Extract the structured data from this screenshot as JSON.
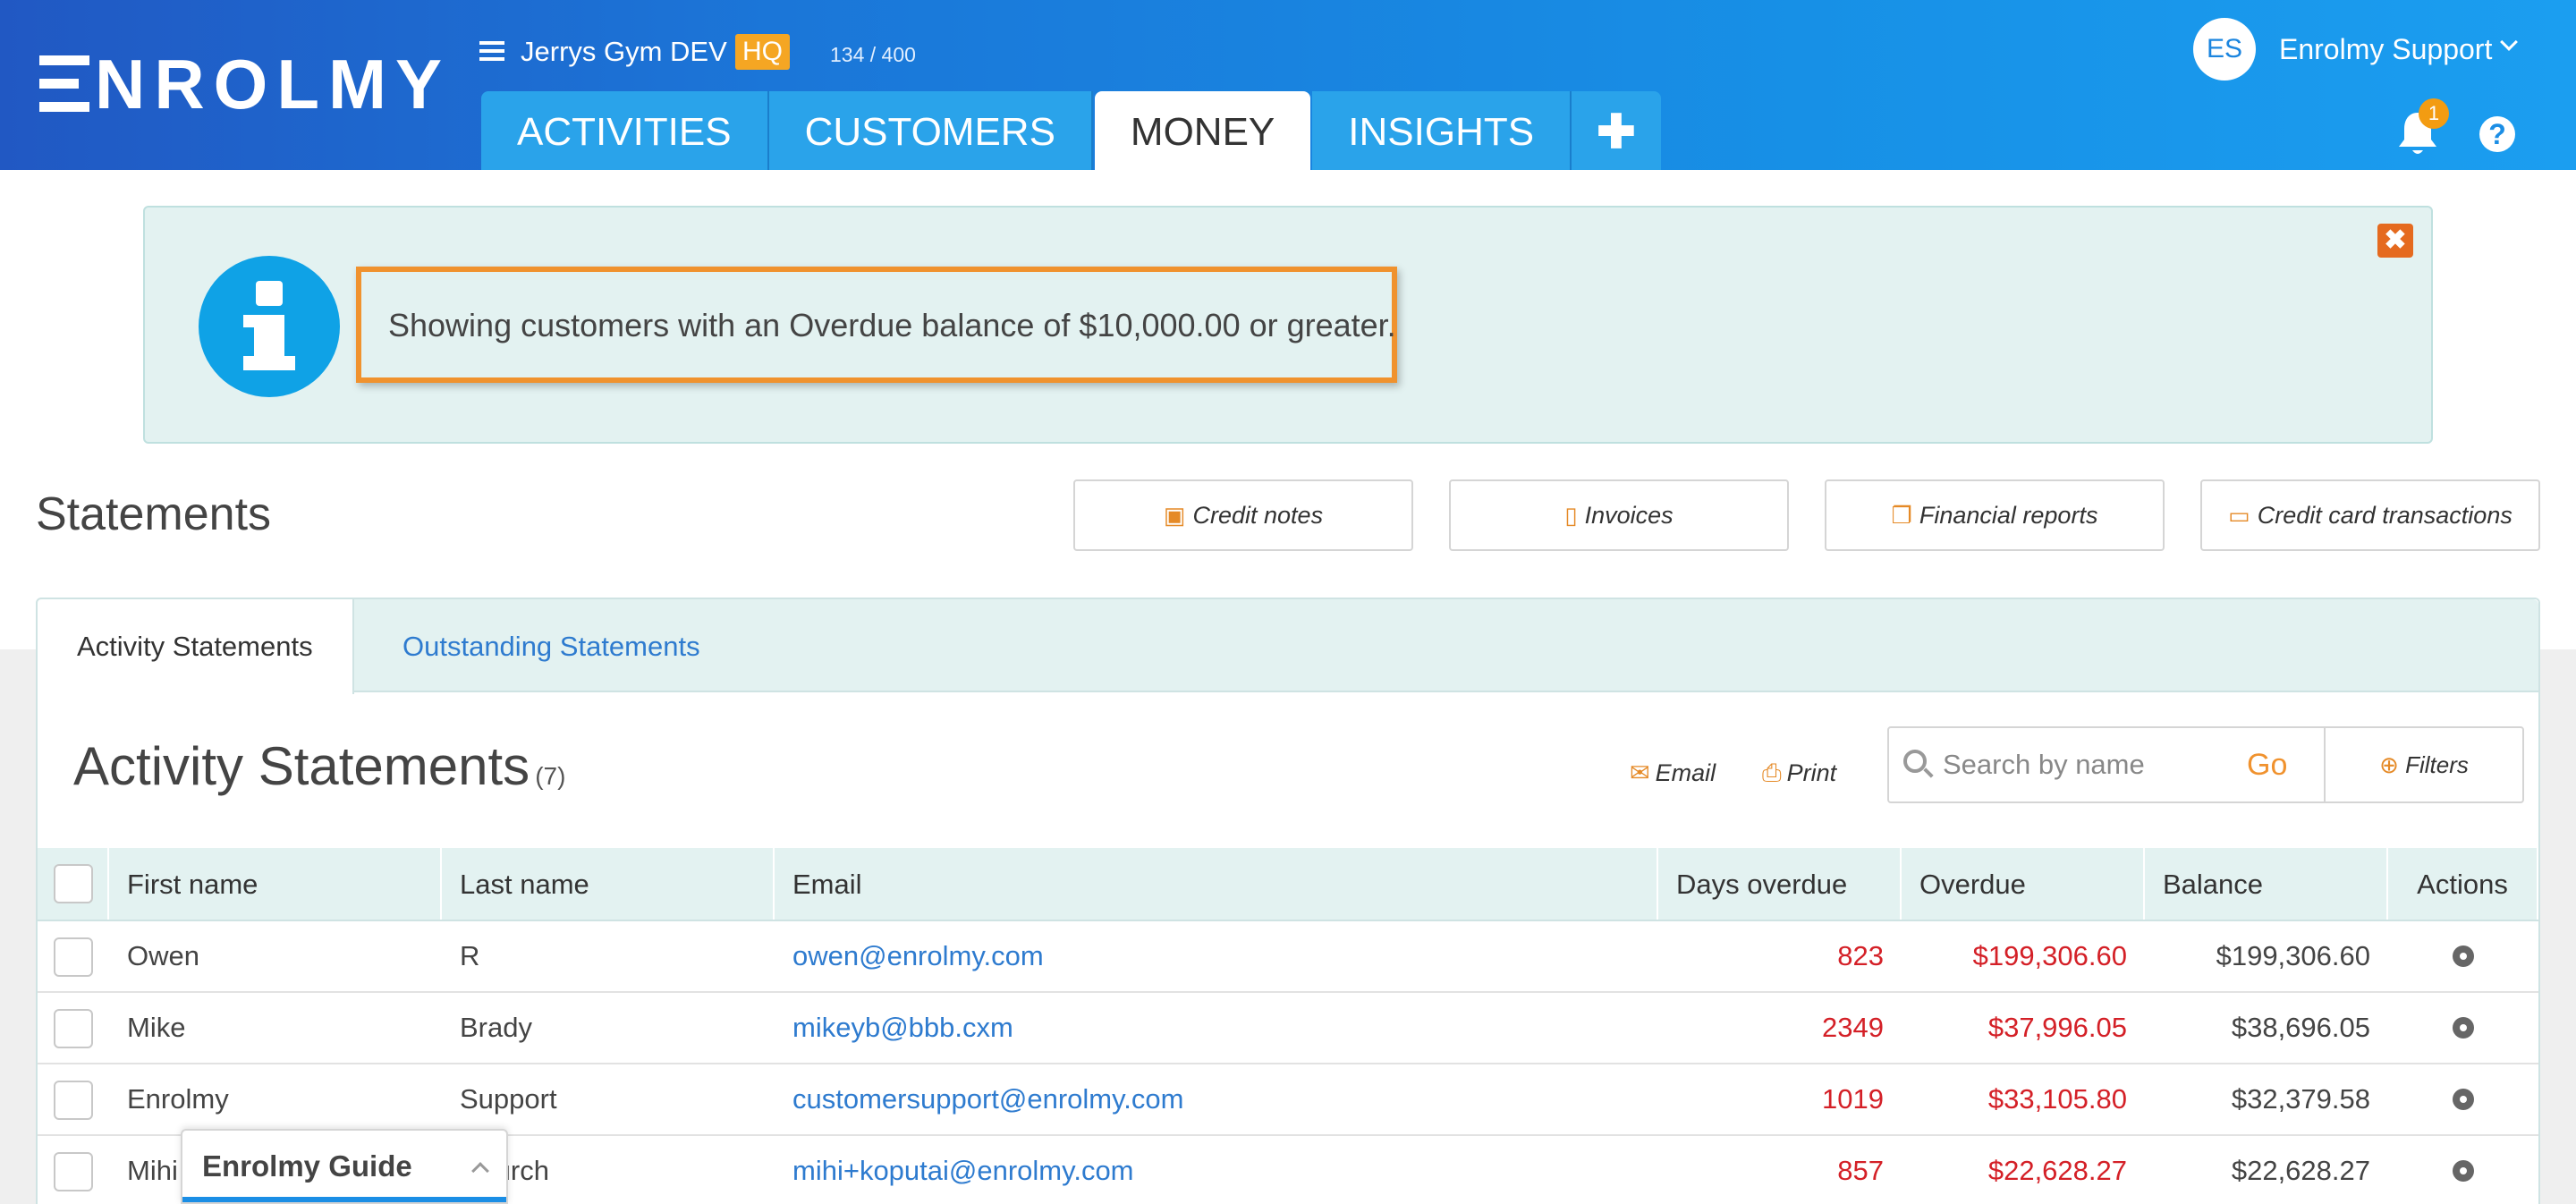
{
  "header": {
    "logo": "ENROLMY",
    "account_name": "Jerrys Gym DEV",
    "account_badge": "HQ",
    "quota": "134 / 400",
    "nav_tabs": [
      {
        "label": "ACTIVITIES"
      },
      {
        "label": "CUSTOMERS"
      },
      {
        "label": "MONEY"
      },
      {
        "label": "INSIGHTS"
      },
      {
        "label": "✚"
      }
    ],
    "user_initials": "ES",
    "user_name": "Enrolmy Support",
    "notification_count": "1",
    "help_label": "?"
  },
  "banner": {
    "message": "Showing customers with an Overdue balance of $10,000.00 or greater.",
    "close_label": "✖"
  },
  "statements": {
    "title": "Statements",
    "buttons": [
      {
        "label": "Credit notes",
        "icon": "money-icon",
        "glyph": "▣"
      },
      {
        "label": "Invoices",
        "icon": "file-icon",
        "glyph": "▯"
      },
      {
        "label": "Financial reports",
        "icon": "copy-icon",
        "glyph": "❐"
      },
      {
        "label": "Credit card transactions",
        "icon": "credit-card-icon",
        "glyph": "▭"
      }
    ],
    "tabs": [
      {
        "label": "Activity Statements"
      },
      {
        "label": "Outstanding Statements"
      }
    ],
    "section_title": "Activity Statements",
    "section_count": "(7)",
    "email_label": "Email",
    "print_label": "Print",
    "search_placeholder": "Search by name",
    "go_label": "Go",
    "filters_label": "Filters"
  },
  "table": {
    "columns": [
      "First name",
      "Last name",
      "Email",
      "Days overdue",
      "Overdue",
      "Balance",
      "Actions"
    ],
    "rows": [
      {
        "first": "Owen",
        "last": "R",
        "email": "owen@enrolmy.com",
        "days": "823",
        "overdue": "$199,306.60",
        "balance": "$199,306.60"
      },
      {
        "first": "Mike",
        "last": "Brady",
        "email": "mikeyb@bbb.cxm",
        "days": "2349",
        "overdue": "$37,996.05",
        "balance": "$38,696.05"
      },
      {
        "first": "Enrolmy",
        "last": "Support",
        "email": "customersupport@enrolmy.com",
        "days": "1019",
        "overdue": "$33,105.80",
        "balance": "$32,379.58"
      },
      {
        "first": "Mihi",
        "last": "Church",
        "email": "mihi+koputai@enrolmy.com",
        "days": "857",
        "overdue": "$22,628.27",
        "balance": "$22,628.27"
      }
    ]
  },
  "guide": {
    "title": "Enrolmy Guide"
  },
  "colors": {
    "header_start": "#2158c3",
    "header_end": "#1b9ef0",
    "accent_orange": "#f0922e",
    "link_blue": "#2e7bcf",
    "overdue_red": "#d42027",
    "banner_bg": "#e3f2f1"
  }
}
